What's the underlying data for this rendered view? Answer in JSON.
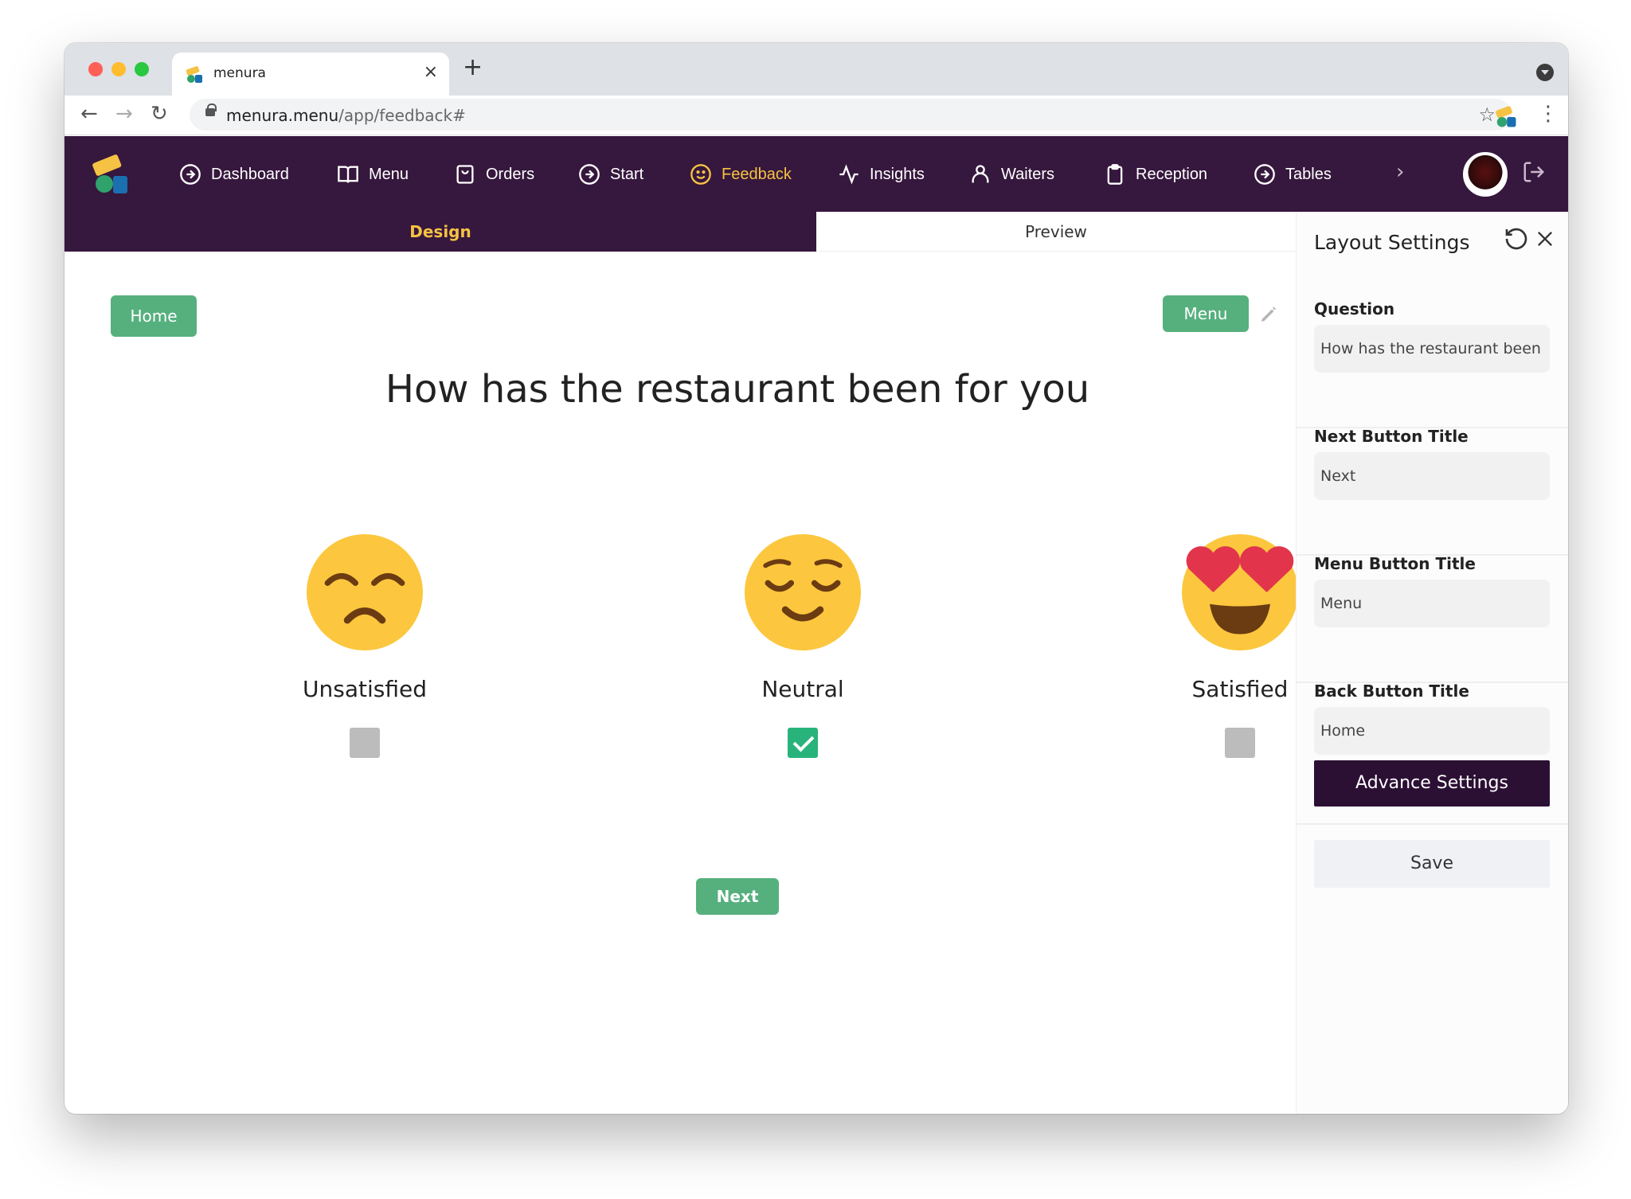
{
  "browser": {
    "tab_title": "menura",
    "url_host": "menura.menu",
    "url_path": "/app/feedback#"
  },
  "nav": {
    "items": [
      {
        "label": "Dashboard",
        "icon": "circle-arrow-icon"
      },
      {
        "label": "Menu",
        "icon": "book-icon"
      },
      {
        "label": "Orders",
        "icon": "shopping-bag-icon"
      },
      {
        "label": "Start",
        "icon": "circle-arrow-icon"
      },
      {
        "label": "Feedback",
        "icon": "smile-icon"
      },
      {
        "label": "Insights",
        "icon": "activity-icon"
      },
      {
        "label": "Waiters",
        "icon": "user-icon"
      },
      {
        "label": "Reception",
        "icon": "clipboard-icon"
      },
      {
        "label": "Tables",
        "icon": "circle-arrow-icon"
      }
    ],
    "active": "Feedback"
  },
  "subtabs": {
    "design": "Design",
    "preview": "Preview"
  },
  "canvas": {
    "home_button": "Home",
    "menu_button": "Menu",
    "question": "How has the restaurant been for you",
    "options": [
      {
        "label": "Unsatisfied",
        "icon": "unamused-face-icon",
        "checked": false
      },
      {
        "label": "Neutral",
        "icon": "relieved-face-icon",
        "checked": true
      },
      {
        "label": "Satisfied",
        "icon": "heart-eyes-face-icon",
        "checked": false
      }
    ],
    "next_button": "Next"
  },
  "panel": {
    "title": "Layout Settings",
    "fields": [
      {
        "label": "Question",
        "value": "How has the restaurant been for you"
      },
      {
        "label": "Next Button Title",
        "value": "Next"
      },
      {
        "label": "Menu Button Title",
        "value": "Menu"
      },
      {
        "label": "Back Button Title",
        "value": "Home"
      }
    ],
    "advance_button": "Advance Settings",
    "save_button": "Save"
  },
  "colors": {
    "nav_bg": "#36173d",
    "accent": "#f6c243",
    "green": "#56b07e",
    "dark_button": "#2c1034"
  }
}
